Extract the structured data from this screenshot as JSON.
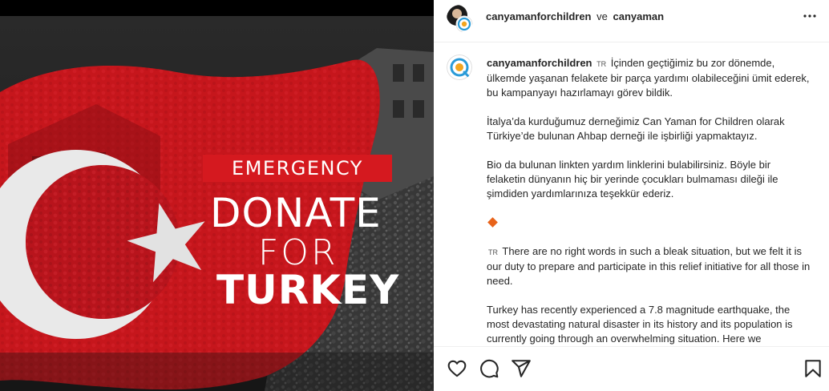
{
  "post": {
    "emergency": "EMERGENCY",
    "donate": "DONATE",
    "for": "FOR",
    "country": "TURKEY"
  },
  "header": {
    "user1": "canyamanforchildren",
    "joiner": "ve",
    "user2": "canyaman"
  },
  "caption": {
    "username": "canyamanforchildren",
    "flag1": "TR",
    "p1": "İçinden geçtiğimiz bu zor dönemde, ülkemde yaşanan felakete bir parça yardımı olabileceğini ümit ederek, bu kampanyayı hazırlamayı görev bildik.",
    "p2": "İtalya’da kurduğumuz derneğimiz Can Yaman for Children olarak Türkiye’de bulunan Ahbap derneği ile işbirliği yapmaktayız.",
    "p3": "Bio da bulunan linkten yardım linklerini bulabilirsiniz. Böyle bir felaketin dünyanın hiç bir yerinde çocukları bulmaması dileği ile şimdiden yardımlarınıza teşekkür ederiz.",
    "flag2": "TR",
    "p4": "There are no right words in such a bleak situation, but we felt it is our duty to prepare and participate in this relief initiative for all those in need.",
    "p5": "Turkey has recently experienced a 7.8 magnitude earthquake, the most devastating natural disaster in its history and its population is currently going through an overwhelming situation. Here we"
  },
  "icons": {
    "more": "more-options-icon",
    "like": "heart-icon",
    "comment": "comment-icon",
    "share": "share-icon",
    "save": "bookmark-icon"
  },
  "colors": {
    "flag_red": "#d5191f",
    "accent_orange": "#e8631a"
  }
}
